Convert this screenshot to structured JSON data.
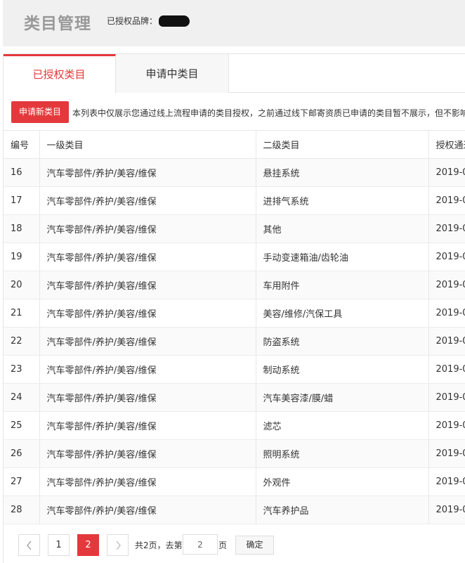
{
  "header": {
    "title": "类目管理",
    "brand_label": "已授权品牌："
  },
  "tabs": [
    {
      "label": "已授权类目",
      "active": true
    },
    {
      "label": "申请中类目",
      "active": false
    }
  ],
  "toolbar": {
    "apply_label": "申请新类目",
    "notice": "本列表中仅展示您通过线上流程申请的类目授权，之前通过线下邮寄资质已申请的类目暂不展示，但不影响"
  },
  "table": {
    "columns": [
      "编号",
      "一级类目",
      "二级类目",
      "授权通过"
    ],
    "rows": [
      {
        "id": "16",
        "level1": "汽车零部件/养护/美容/维保",
        "level2": "悬挂系统",
        "date": "2019-0"
      },
      {
        "id": "17",
        "level1": "汽车零部件/养护/美容/维保",
        "level2": "进排气系统",
        "date": "2019-0"
      },
      {
        "id": "18",
        "level1": "汽车零部件/养护/美容/维保",
        "level2": "其他",
        "date": "2019-0"
      },
      {
        "id": "19",
        "level1": "汽车零部件/养护/美容/维保",
        "level2": "手动变速箱油/齿轮油",
        "date": "2019-0"
      },
      {
        "id": "20",
        "level1": "汽车零部件/养护/美容/维保",
        "level2": "车用附件",
        "date": "2019-0"
      },
      {
        "id": "21",
        "level1": "汽车零部件/养护/美容/维保",
        "level2": "美容/维修/汽保工具",
        "date": "2019-0"
      },
      {
        "id": "22",
        "level1": "汽车零部件/养护/美容/维保",
        "level2": "防盗系统",
        "date": "2019-0"
      },
      {
        "id": "23",
        "level1": "汽车零部件/养护/美容/维保",
        "level2": "制动系统",
        "date": "2019-0"
      },
      {
        "id": "24",
        "level1": "汽车零部件/养护/美容/维保",
        "level2": "汽车美容漆/膜/蜡",
        "date": "2019-0"
      },
      {
        "id": "25",
        "level1": "汽车零部件/养护/美容/维保",
        "level2": "滤芯",
        "date": "2019-0"
      },
      {
        "id": "26",
        "level1": "汽车零部件/养护/美容/维保",
        "level2": "照明系统",
        "date": "2019-0"
      },
      {
        "id": "27",
        "level1": "汽车零部件/养护/美容/维保",
        "level2": "外观件",
        "date": "2019-0"
      },
      {
        "id": "28",
        "level1": "汽车零部件/养护/美容/维保",
        "level2": "汽车养护品",
        "date": "2019-0"
      }
    ]
  },
  "pagination": {
    "prev_icon": "chevron-left-icon",
    "next_icon": "chevron-right-icon",
    "pages": [
      "1",
      "2"
    ],
    "current": "2",
    "total_text": "共2页，去第",
    "goto_value": "2",
    "unit_text": "页",
    "confirm_label": "确定"
  },
  "colors": {
    "accent": "#e4393c"
  }
}
